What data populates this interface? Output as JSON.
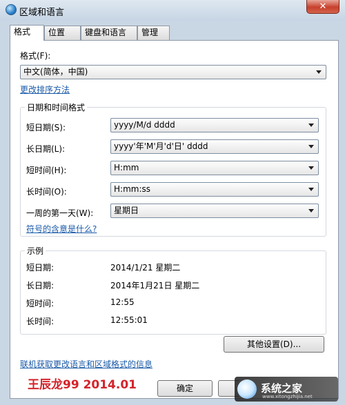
{
  "window": {
    "title": "区域和语言",
    "close_glyph": "✕"
  },
  "tabs": [
    {
      "label": "格式",
      "active": true
    },
    {
      "label": "位置"
    },
    {
      "label": "键盘和语言"
    },
    {
      "label": "管理"
    }
  ],
  "format": {
    "label": "格式(F):",
    "value": "中文(简体，中国)",
    "change_sort_link": "更改排序方法"
  },
  "datetime_group": {
    "title": "日期和时间格式",
    "rows": [
      {
        "label": "短日期(S):",
        "value": "yyyy/M/d dddd"
      },
      {
        "label": "长日期(L):",
        "value": "yyyy'年'M'月'd'日' dddd"
      },
      {
        "label": "短时间(H):",
        "value": "H:mm"
      },
      {
        "label": "长时间(O):",
        "value": "H:mm:ss"
      },
      {
        "label": "一周的第一天(W):",
        "value": "星期日"
      }
    ],
    "symbols_link": "符号的含意是什么?"
  },
  "example_group": {
    "title": "示例",
    "rows": [
      {
        "label": "短日期:",
        "value": "2014/1/21 星期二"
      },
      {
        "label": "长日期:",
        "value": "2014年1月21日 星期二"
      },
      {
        "label": "短时间:",
        "value": "12:55"
      },
      {
        "label": "长时间:",
        "value": "12:55:01"
      }
    ]
  },
  "other_settings_button": "其他设置(D)...",
  "online_info_link": "联机获取更改语言和区域格式的信息",
  "buttons": {
    "ok": "确定"
  },
  "watermark": {
    "signature": "王辰龙99 2014.01",
    "site_name": "系统之家",
    "site_url": "www.xitongzhijia.net"
  }
}
